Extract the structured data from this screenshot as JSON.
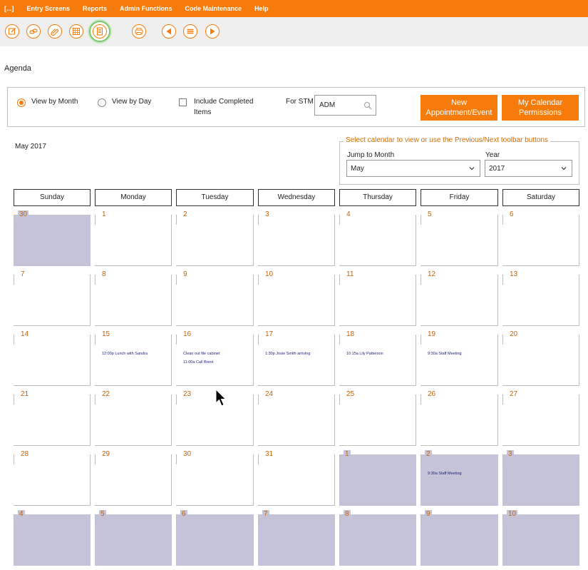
{
  "menu": [
    "[...]",
    "Entry Screens",
    "Reports",
    "Admin Functions",
    "Code Maintenance",
    "Help"
  ],
  "toolbar": {
    "icons": [
      "edit-icon",
      "link-icon",
      "attachment-icon",
      "calendar-grid-icon",
      "agenda-icon",
      "print-icon",
      "previous-icon",
      "list-icon",
      "next-icon"
    ],
    "accent": "#f77b0b",
    "active_highlight": "#7bc46e"
  },
  "page_title": "Agenda",
  "filters": {
    "view_by_month": "View by Month",
    "view_by_day": "View by Day",
    "include_completed_1": "Include Completed",
    "include_completed_2": "Items",
    "for_stm_label": "For STM",
    "stm_value": "ADM",
    "selected_view": "month",
    "include_completed_checked": false
  },
  "buttons": {
    "new_appt_1": "New",
    "new_appt_2": "Appointment/Event",
    "permissions_1": "My Calendar",
    "permissions_2": "Permissions"
  },
  "calendar": {
    "month_label": "May 2017",
    "nav_legend": "Select calendar to view or use the Previous/Next toolbar buttons",
    "jump_label": "Jump to Month",
    "jump_value": "May",
    "year_label": "Year",
    "year_value": "2017",
    "day_headers": [
      "Sunday",
      "Monday",
      "Tuesday",
      "Wednesday",
      "Thursday",
      "Friday",
      "Saturday"
    ],
    "other_month_color": "#c4c3d8",
    "weeks": [
      [
        {
          "d": "30",
          "other": true,
          "ev": []
        },
        {
          "d": "1",
          "ev": []
        },
        {
          "d": "2",
          "ev": []
        },
        {
          "d": "3",
          "ev": []
        },
        {
          "d": "4",
          "ev": []
        },
        {
          "d": "5",
          "ev": []
        },
        {
          "d": "6",
          "ev": []
        }
      ],
      [
        {
          "d": "7",
          "ev": []
        },
        {
          "d": "8",
          "ev": []
        },
        {
          "d": "9",
          "ev": []
        },
        {
          "d": "10",
          "ev": []
        },
        {
          "d": "11",
          "ev": []
        },
        {
          "d": "12",
          "ev": []
        },
        {
          "d": "13",
          "ev": []
        }
      ],
      [
        {
          "d": "14",
          "ev": []
        },
        {
          "d": "15",
          "ev": [
            "12:00p Lunch with Sandra"
          ]
        },
        {
          "d": "16",
          "ev": [
            "Clean out file cabinet",
            "11:00a Call Brent"
          ]
        },
        {
          "d": "17",
          "ev": [
            "1:30p Josie Smith arriving"
          ]
        },
        {
          "d": "18",
          "ev": [
            "10:15a Lily Patterson"
          ]
        },
        {
          "d": "19",
          "ev": [
            "9:30a Staff Meeting"
          ]
        },
        {
          "d": "20",
          "ev": []
        }
      ],
      [
        {
          "d": "21",
          "ev": []
        },
        {
          "d": "22",
          "ev": []
        },
        {
          "d": "23",
          "ev": []
        },
        {
          "d": "24",
          "ev": []
        },
        {
          "d": "25",
          "ev": []
        },
        {
          "d": "26",
          "ev": []
        },
        {
          "d": "27",
          "ev": []
        }
      ],
      [
        {
          "d": "28",
          "ev": []
        },
        {
          "d": "29",
          "ev": []
        },
        {
          "d": "30",
          "ev": []
        },
        {
          "d": "31",
          "ev": []
        },
        {
          "d": "1",
          "other": true,
          "ev": []
        },
        {
          "d": "2",
          "other": true,
          "ev": [
            "9:30a Staff Meeting"
          ]
        },
        {
          "d": "3",
          "other": true,
          "ev": []
        }
      ],
      [
        {
          "d": "4",
          "other": true,
          "ev": []
        },
        {
          "d": "5",
          "other": true,
          "ev": []
        },
        {
          "d": "6",
          "other": true,
          "ev": []
        },
        {
          "d": "7",
          "other": true,
          "ev": []
        },
        {
          "d": "8",
          "other": true,
          "ev": []
        },
        {
          "d": "9",
          "other": true,
          "ev": []
        },
        {
          "d": "10",
          "other": true,
          "ev": []
        }
      ]
    ]
  }
}
